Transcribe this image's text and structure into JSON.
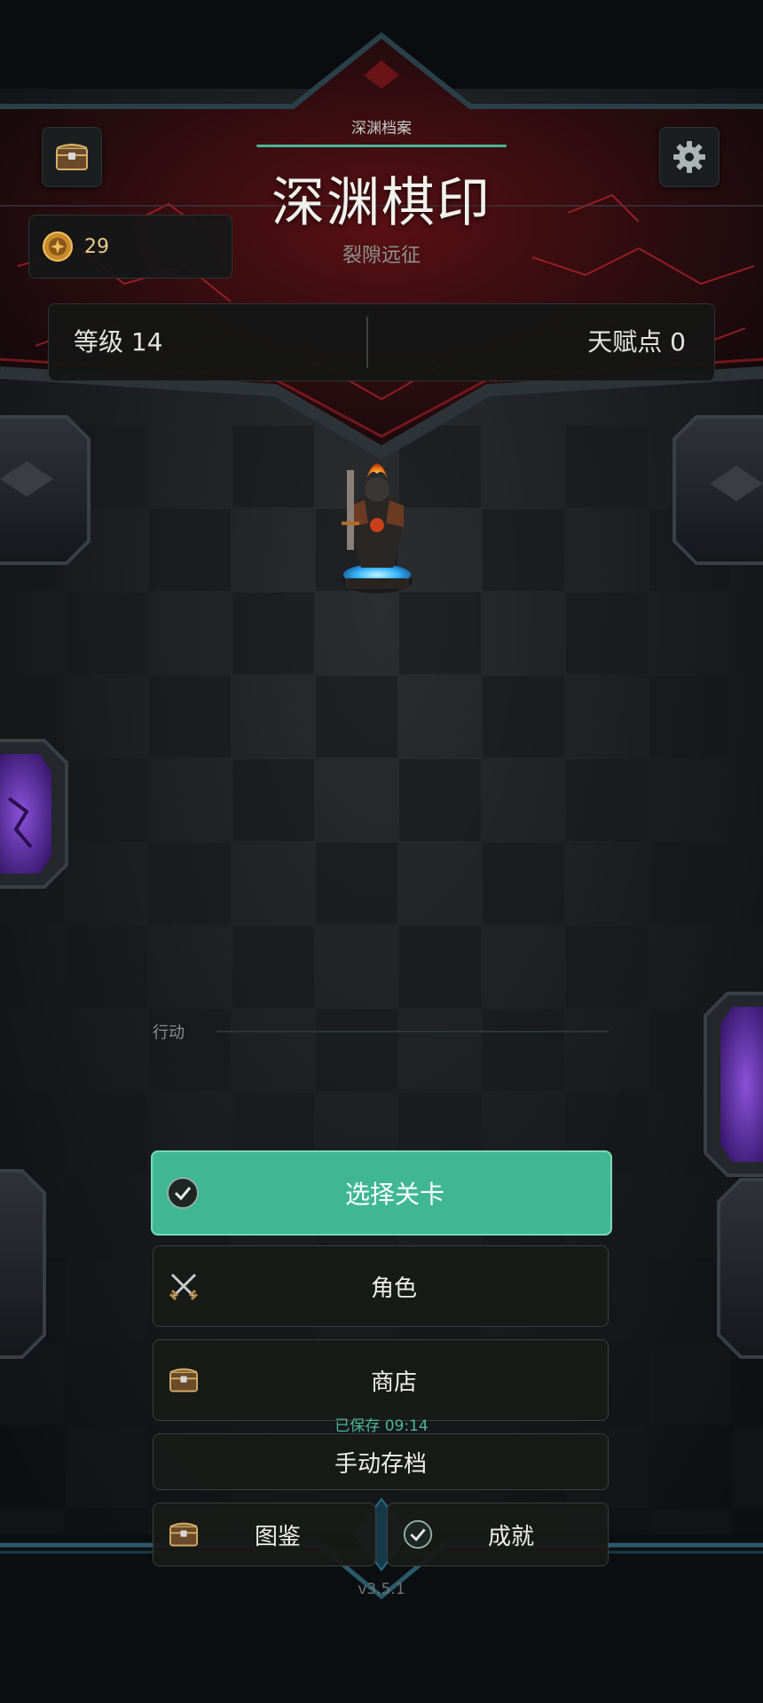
{
  "header": {
    "section_tag": "深渊档案",
    "title": "深渊棋印",
    "subtitle": "裂隙远征"
  },
  "currency": {
    "icon": "coin-icon",
    "value": "29"
  },
  "stats": {
    "level": "等级 14",
    "talent_points": "天赋点 0"
  },
  "action": {
    "label": "行动"
  },
  "menu": {
    "select_level": "选择关卡",
    "character": "角色",
    "shop": "商店",
    "save_status": "已保存 09:14",
    "manual_save": "手动存档",
    "codex": "图鉴",
    "achievements": "成就"
  },
  "version": "v3.5.1",
  "colors": {
    "accent": "#3fb892",
    "accent_border": "#7ad9b8",
    "lava": "#b8242c",
    "portal": "#6a35b8",
    "gold": "#e8c98a"
  },
  "icons": {
    "top_left": "treasure-chest-icon",
    "top_right": "gear-icon",
    "select_level": "check-circle-icon",
    "character": "crossed-swords-icon",
    "shop": "treasure-chest-icon",
    "codex": "treasure-chest-icon",
    "achievements": "check-circle-icon"
  }
}
